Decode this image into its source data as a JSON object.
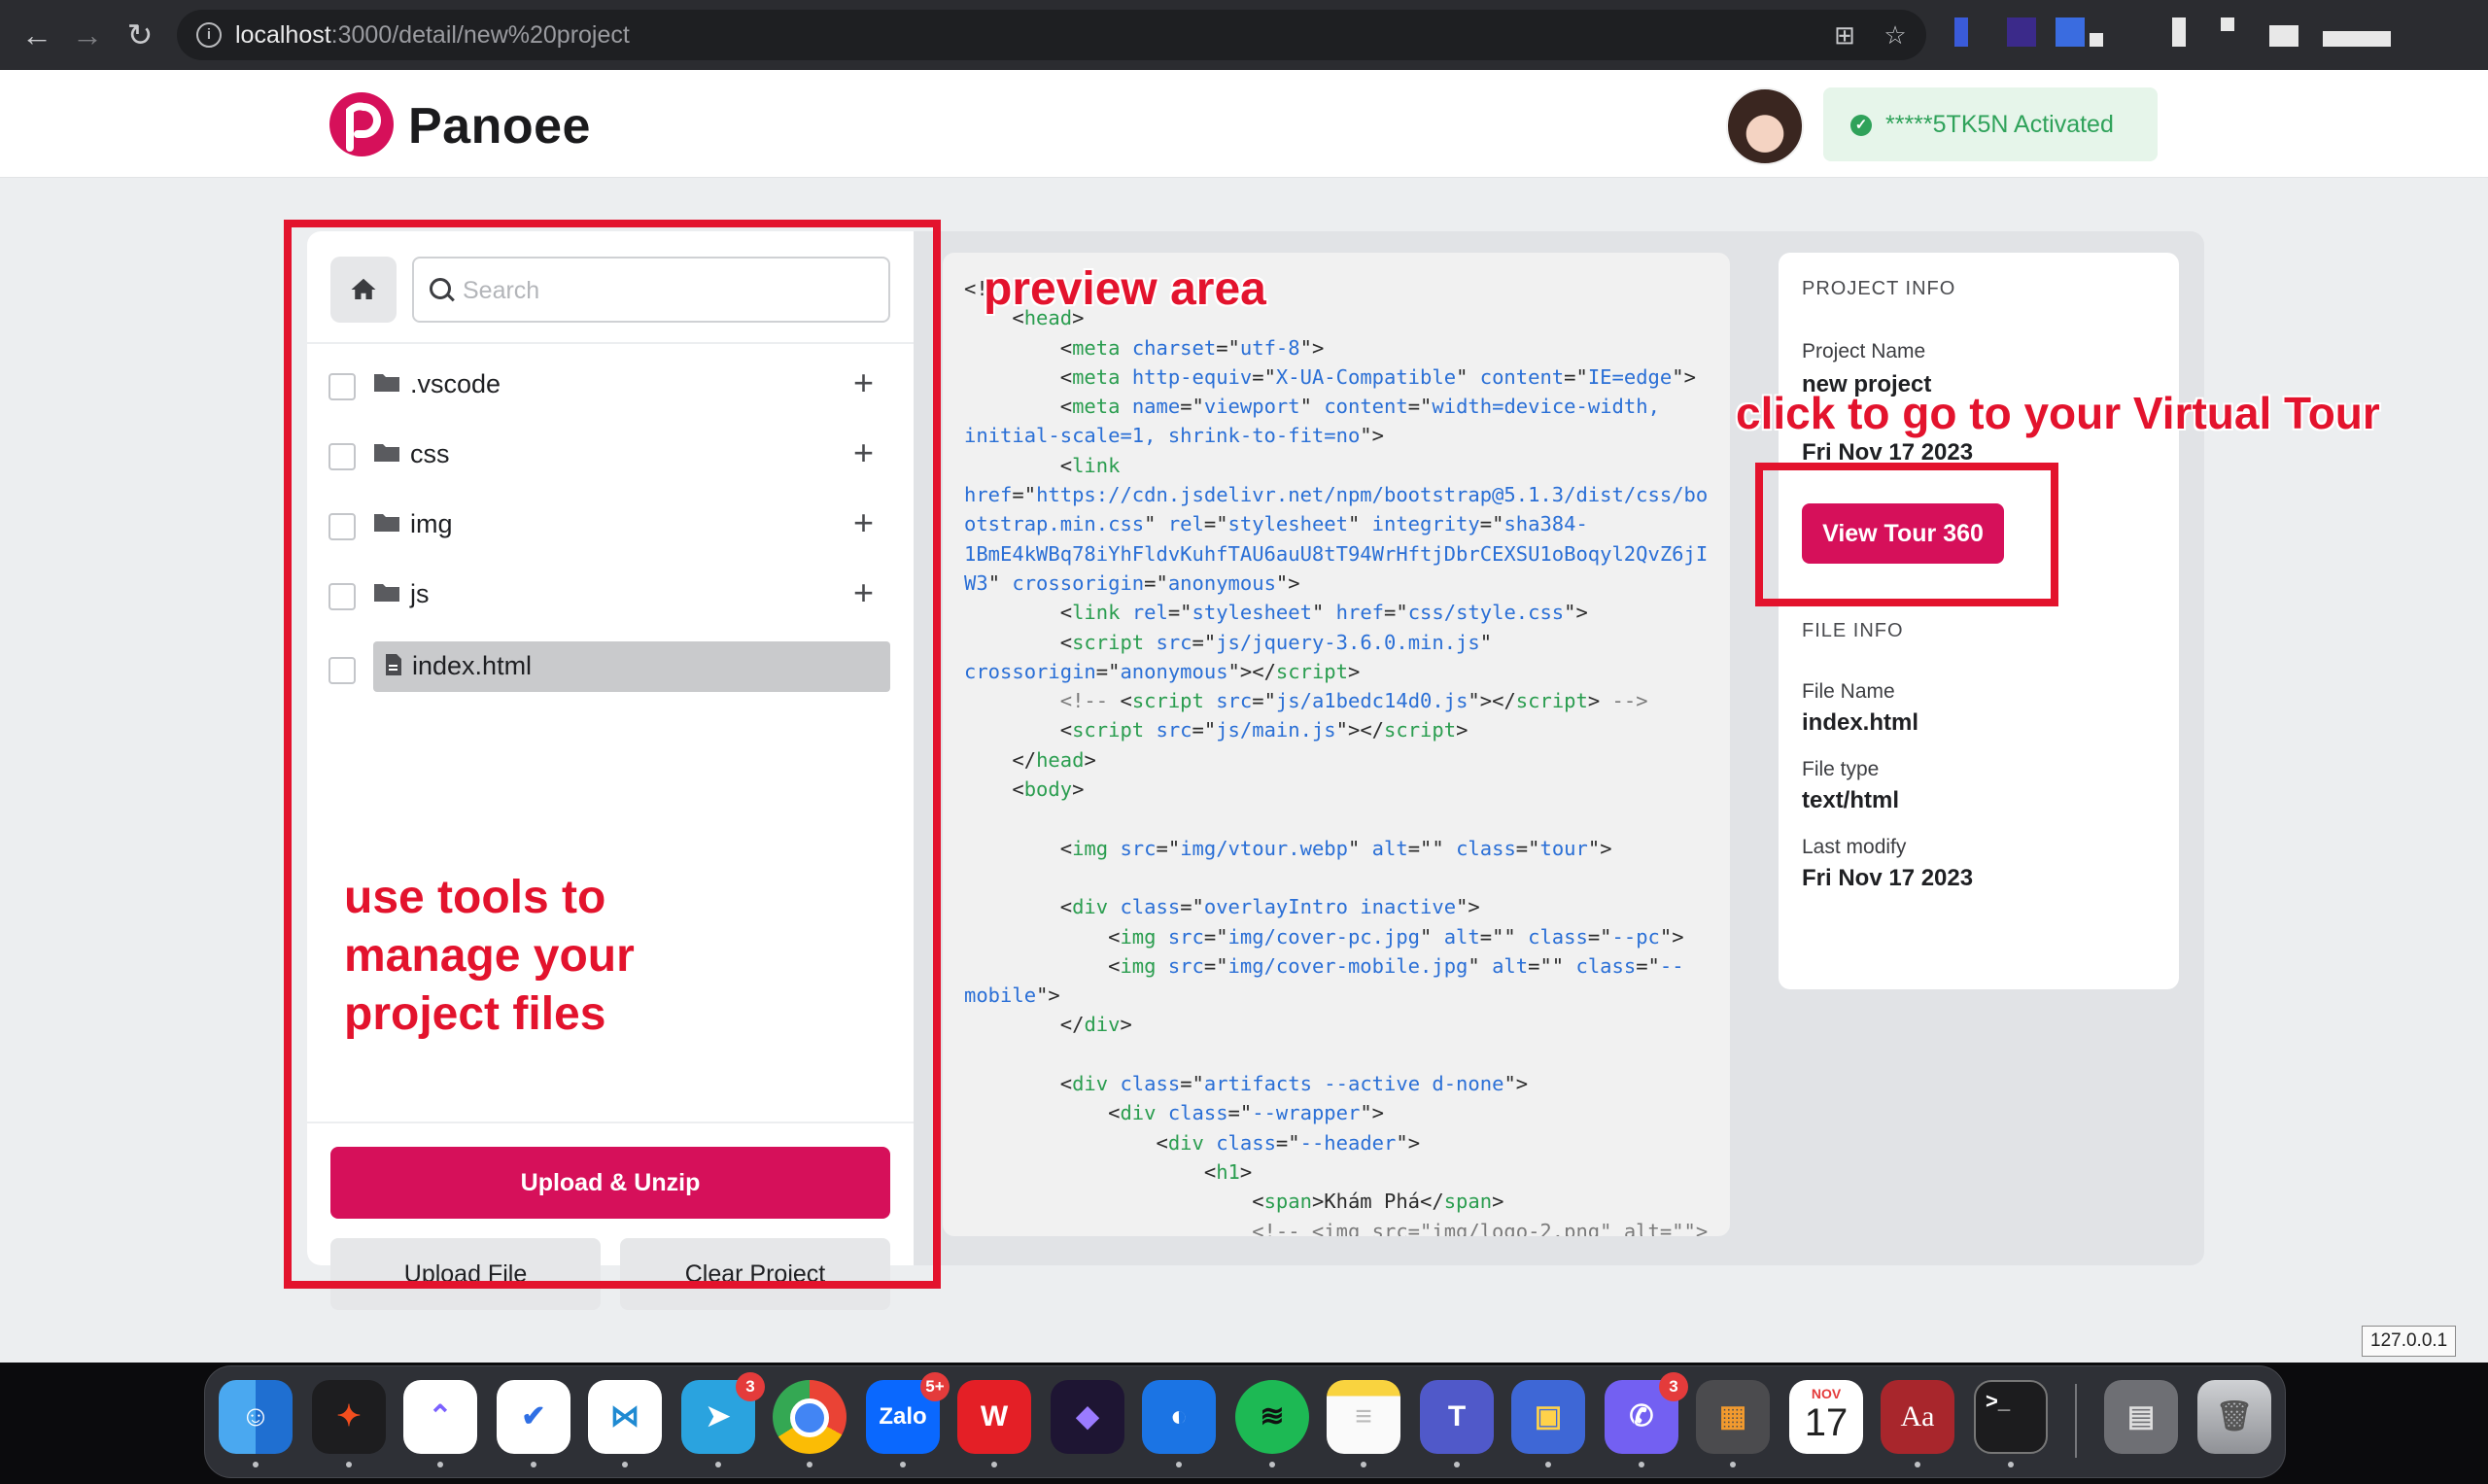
{
  "browser": {
    "url_host": "localhost",
    "url_rest": ":3000/detail/new%20project"
  },
  "header": {
    "logo_text": "Panoee",
    "license_text": "*****5TK5N Activated"
  },
  "file_manager": {
    "search_placeholder": "Search",
    "items": [
      {
        "name": ".vscode",
        "type": "folder"
      },
      {
        "name": "css",
        "type": "folder"
      },
      {
        "name": "img",
        "type": "folder"
      },
      {
        "name": "js",
        "type": "folder"
      },
      {
        "name": "index.html",
        "type": "file",
        "selected": true
      }
    ],
    "upload_unzip_label": "Upload & Unzip",
    "upload_file_label": "Upload File",
    "clear_project_label": "Clear Project"
  },
  "project_info": {
    "title": "PROJECT INFO",
    "name_label": "Project Name",
    "name_value": "new project",
    "date_value": "Fri Nov 17 2023",
    "view_tour_label": "View Tour 360"
  },
  "file_info": {
    "title": "FILE INFO",
    "name_label": "File Name",
    "name_value": "index.html",
    "type_label": "File type",
    "type_value": "text/html",
    "modify_label": "Last modify",
    "modify_value": "Fri Nov 17 2023"
  },
  "annotations": {
    "preview": "preview area",
    "tour": "click to go to your Virtual Tour",
    "tools_line1": "use tools to",
    "tools_line2": "manage your",
    "tools_line3": "project files"
  },
  "ip_label": "127.0.0.1",
  "dock": {
    "badges": {
      "telegram": "3",
      "zalo": "5+",
      "viber": "3"
    },
    "calendar_month": "NOV",
    "calendar_day": "17"
  },
  "colors": {
    "brand": "#d6105a",
    "annotation": "#e3132d",
    "success": "#2fa25a"
  }
}
